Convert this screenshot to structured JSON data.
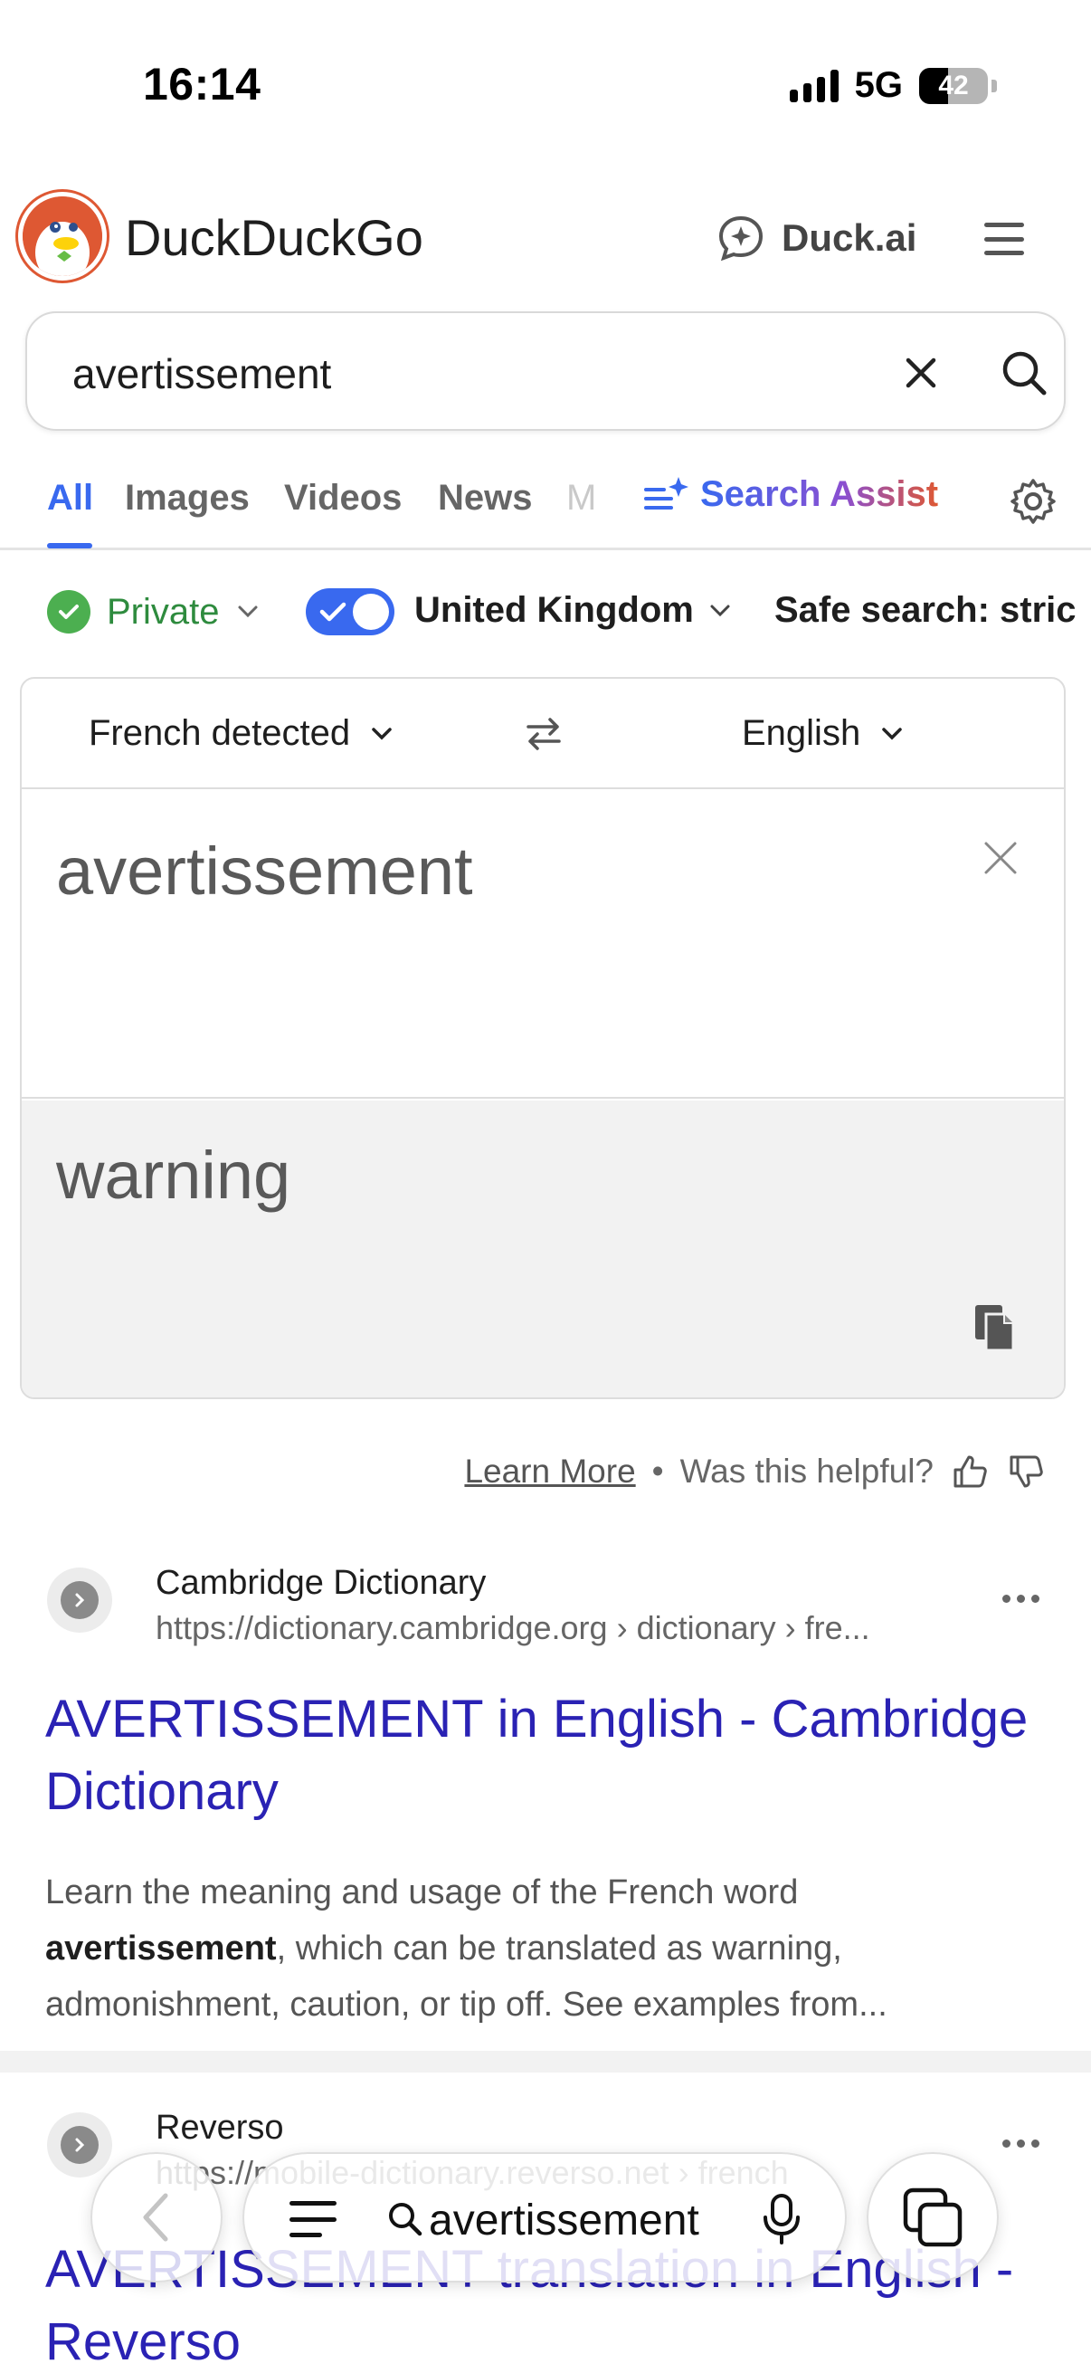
{
  "status_bar": {
    "time": "16:14",
    "network": "5G",
    "battery": "42",
    "battery_level": 0.42
  },
  "header": {
    "brand": "DuckDuckGo",
    "duckai_label": "Duck.ai"
  },
  "search": {
    "query": "avertissement"
  },
  "tabs": {
    "all": "All",
    "images": "Images",
    "videos": "Videos",
    "news": "News",
    "maps_partial": "M",
    "search_assist": "Search Assist"
  },
  "filters": {
    "private": "Private",
    "region": "United Kingdom",
    "region_toggle_on": true,
    "safe_search": "Safe search: stric"
  },
  "translator": {
    "source_lang": "French detected",
    "target_lang": "English",
    "input": "avertissement",
    "output": "warning"
  },
  "feedback": {
    "learn_more": "Learn More",
    "separator": "•",
    "question": "Was this helpful?"
  },
  "results": [
    {
      "site": "Cambridge Dictionary",
      "url": "https://dictionary.cambridge.org › dictionary › fre...",
      "title": "AVERTISSEMENT in English - Cambridge Dictionary",
      "snippet_pre": "Learn the meaning and usage of the French word ",
      "snippet_bold": "avertissement",
      "snippet_post": ", which can be translated as warning, admonishment, caution, or tip off. See examples from..."
    },
    {
      "site": "Reverso",
      "url": "https://mobile-dictionary.reverso.net › french",
      "title": "AVERTISSEMENT translation in English - Reverso"
    }
  ],
  "bottom_bar": {
    "address_text": "avertissement"
  },
  "colors": {
    "accent": "#3969ef",
    "link": "#2a22b4",
    "private_green": "#2e8b3e",
    "brand_orange": "#de5833"
  }
}
